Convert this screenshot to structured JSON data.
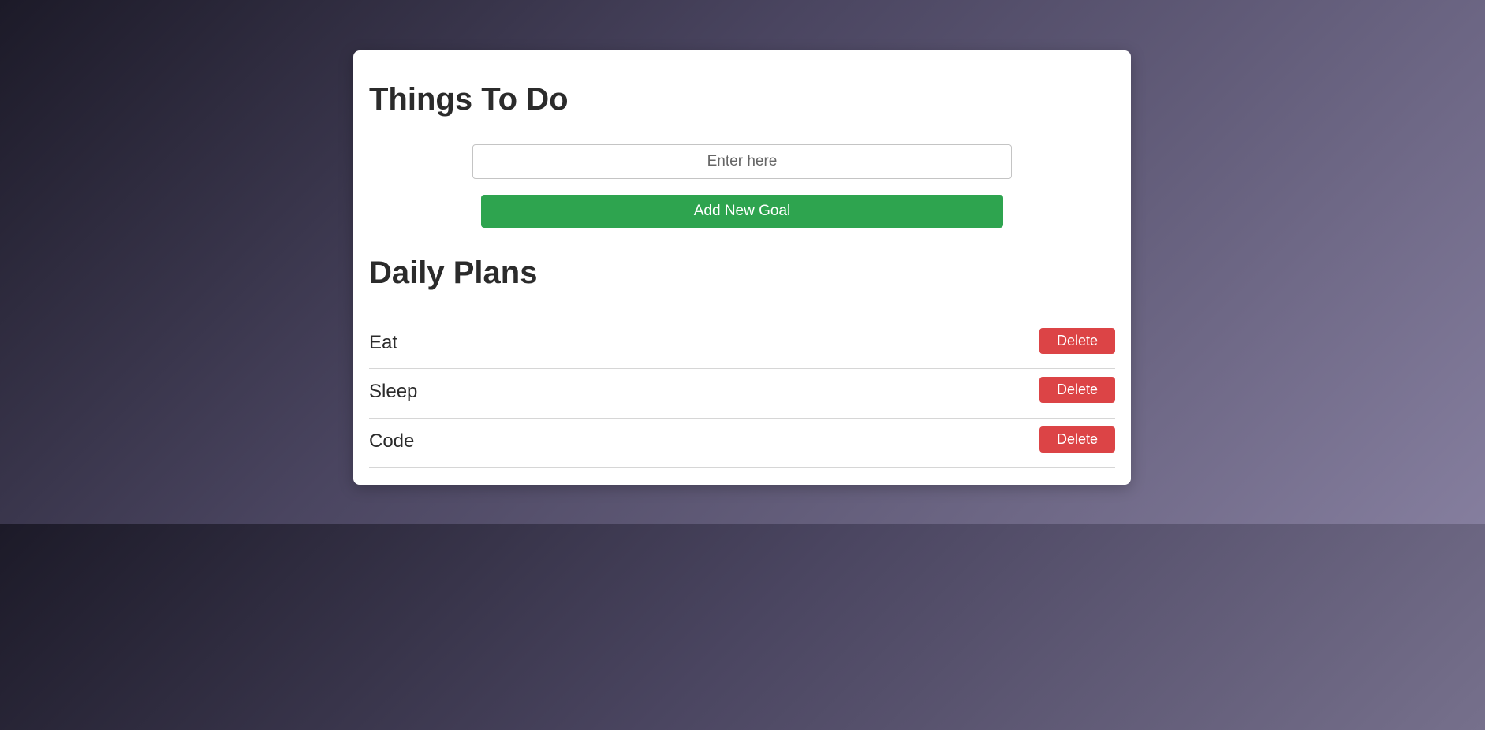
{
  "app": {
    "title": "Things To Do"
  },
  "form": {
    "input_value": "",
    "input_placeholder": "Enter here",
    "add_label": "Add New Goal"
  },
  "list": {
    "heading": "Daily Plans",
    "items": [
      {
        "label": "Eat",
        "delete_label": "Delete"
      },
      {
        "label": "Sleep",
        "delete_label": "Delete"
      },
      {
        "label": "Code",
        "delete_label": "Delete"
      }
    ]
  },
  "colors": {
    "add_button": "#2ea44f",
    "delete_button": "#dc4446",
    "heading_text": "#2b2b2b"
  }
}
